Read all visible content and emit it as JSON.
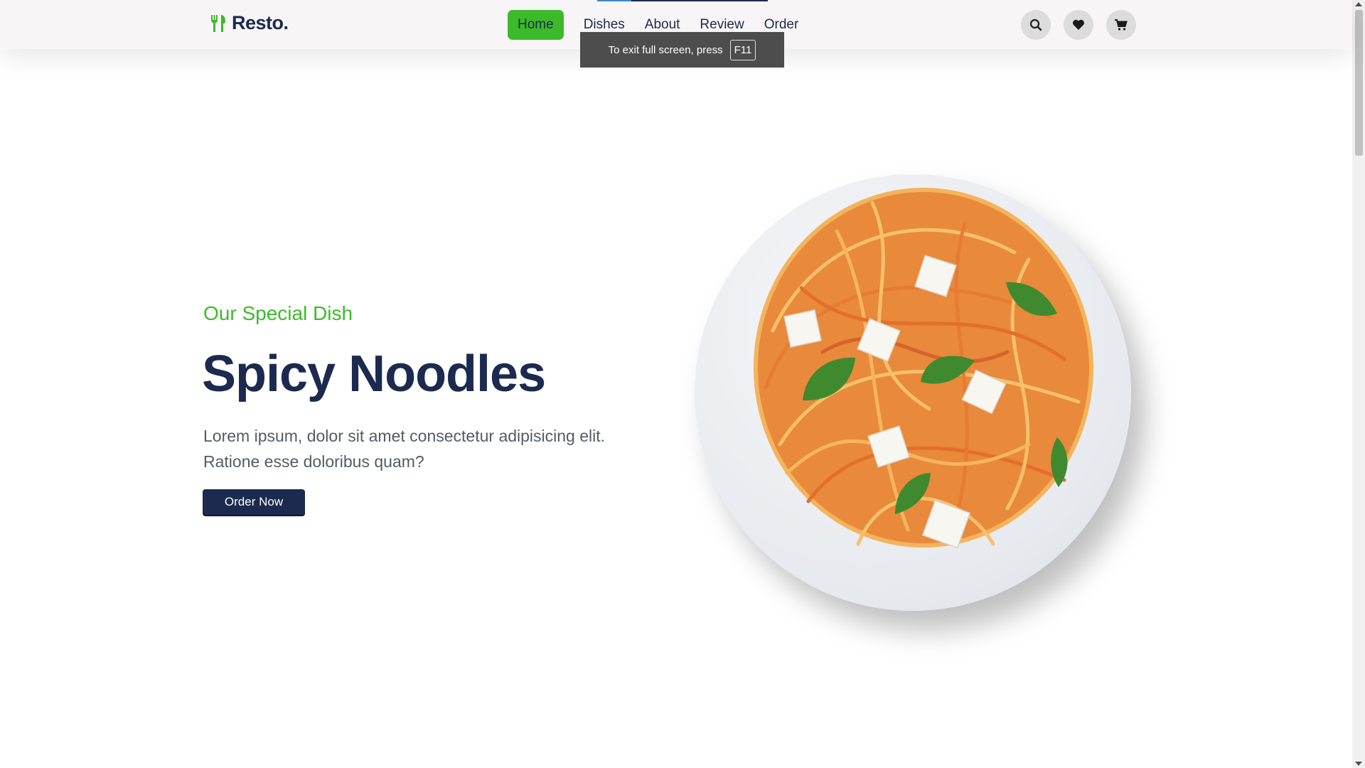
{
  "header": {
    "logo_text": "Resto.",
    "nav": [
      {
        "label": "Home",
        "active": true
      },
      {
        "label": "Dishes",
        "active": false
      },
      {
        "label": "About",
        "active": false
      },
      {
        "label": "Review",
        "active": false
      },
      {
        "label": "Order",
        "active": false
      }
    ],
    "icons": [
      "search-icon",
      "heart-icon",
      "cart-icon"
    ]
  },
  "fullscreen_toast": {
    "text": "To exit full screen, press",
    "key": "F11"
  },
  "hero": {
    "tagline": "Our Special Dish",
    "title": "Spicy Noodles",
    "description": "Lorem ipsum, dolor sit amet consectetur adipisicing elit. Ratione esse doloribus quam?",
    "button_label": "Order Now"
  },
  "colors": {
    "accent_green": "#3cba2a",
    "navy": "#1b2a4e",
    "header_bg": "#f7f5f5",
    "text_gray": "#555b66"
  }
}
